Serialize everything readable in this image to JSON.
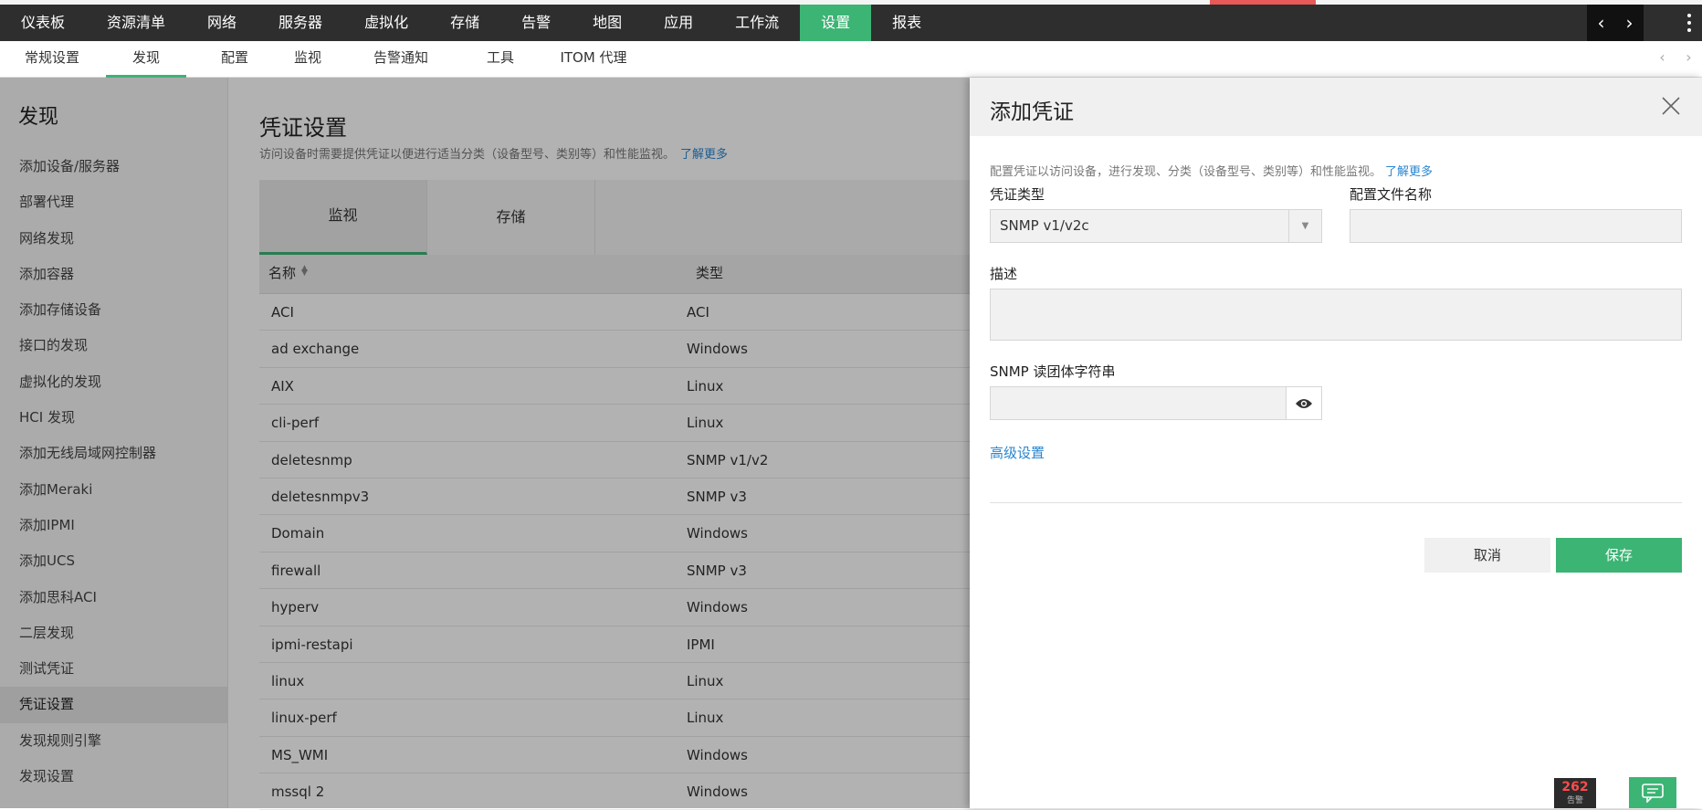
{
  "topnav": {
    "items": [
      "仪表板",
      "资源清单",
      "网络",
      "服务器",
      "虚拟化",
      "存储",
      "告警",
      "地图",
      "应用",
      "工作流",
      "设置",
      "报表"
    ],
    "active_index": 10
  },
  "subnav": {
    "items": [
      "常规设置",
      "发现",
      "配置",
      "监视",
      "告警通知",
      "工具",
      "ITOM 代理"
    ],
    "active_index": 1
  },
  "sidebar": {
    "heading": "发现",
    "items": [
      "添加设备/服务器",
      "部署代理",
      "网络发现",
      "添加容器",
      "添加存储设备",
      "接口的发现",
      "虚拟化的发现",
      "HCI 发现",
      "添加无线局域网控制器",
      "添加Meraki",
      "添加IPMI",
      "添加UCS",
      "添加思科ACI",
      "二层发现",
      "测试凭证",
      "凭证设置",
      "发现规则引擎",
      "发现设置"
    ],
    "active_index": 15
  },
  "main": {
    "title": "凭证设置",
    "subtitle": "访问设备时需要提供凭证以便进行适当分类（设备型号、类别等）和性能监视。",
    "learn_more": "了解更多",
    "tabs": [
      "监视",
      "存储"
    ],
    "active_tab": 0,
    "columns": [
      "名称",
      "类型"
    ],
    "rows": [
      [
        "ACI",
        "ACI"
      ],
      [
        "ad exchange",
        "Windows"
      ],
      [
        "AIX",
        "Linux"
      ],
      [
        "cli-perf",
        "Linux"
      ],
      [
        "deletesnmp",
        "SNMP v1/v2"
      ],
      [
        "deletesnmpv3",
        "SNMP v3"
      ],
      [
        "Domain",
        "Windows"
      ],
      [
        "firewall",
        "SNMP v3"
      ],
      [
        "hyperv",
        "Windows"
      ],
      [
        "ipmi-restapi",
        "IPMI"
      ],
      [
        "linux",
        "Linux"
      ],
      [
        "linux-perf",
        "Linux"
      ],
      [
        "MS_WMI",
        "Windows"
      ],
      [
        "mssql 2",
        "Windows"
      ]
    ]
  },
  "panel": {
    "title": "添加凭证",
    "description": "配置凭证以访问设备，进行发现、分类（设备型号、类别等）和性能监视。",
    "learn_more": "了解更多",
    "credential_type_label": "凭证类型",
    "credential_type_value": "SNMP v1/v2c",
    "profile_name_label": "配置文件名称",
    "profile_name_value": "",
    "description_label": "描述",
    "description_value": "",
    "community_label": "SNMP 读团体字符串",
    "community_value": "",
    "advanced_link": "高级设置",
    "cancel_label": "取消",
    "save_label": "保存"
  },
  "badge": {
    "count": "262",
    "label": "告警"
  },
  "colors": {
    "accent": "#3cb474",
    "topnav": "#2e2e2e",
    "link": "#2a86d1",
    "alert": "#e8595a"
  }
}
